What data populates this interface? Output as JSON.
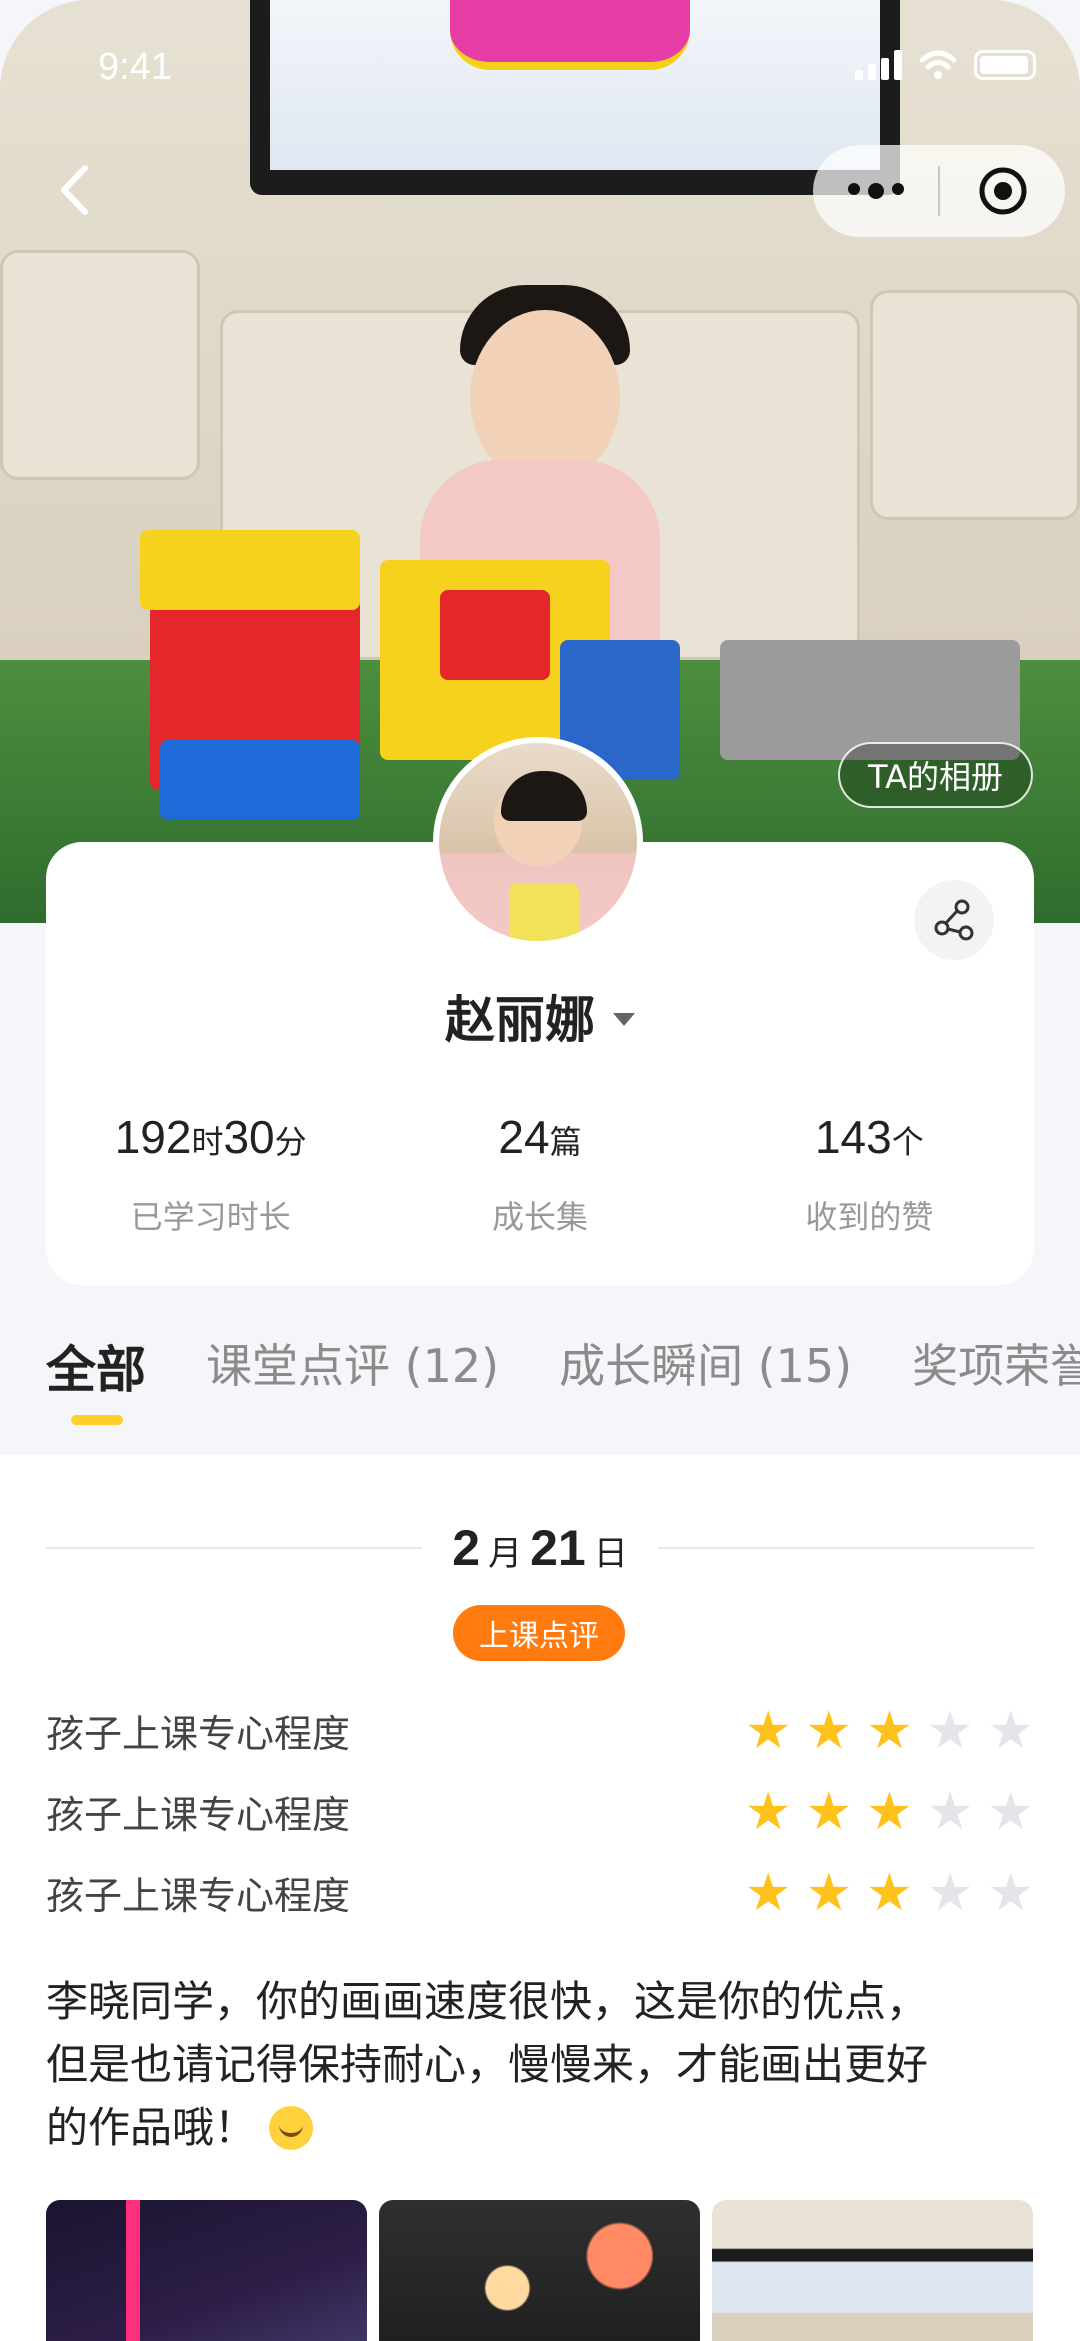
{
  "status_bar": {
    "time": "9:41"
  },
  "hero": {
    "album_button": "TA的相册"
  },
  "profile": {
    "name": "赵丽娜"
  },
  "stats": [
    {
      "num1": "192",
      "unit1": "时",
      "num2": "30",
      "unit2": "分",
      "label": "已学习时长"
    },
    {
      "num1": "24",
      "unit1": "篇",
      "label": "成长集"
    },
    {
      "num1": "143",
      "unit1": "个",
      "label": "收到的赞"
    }
  ],
  "tabs": [
    "全部",
    "课堂点评 (12)",
    "成长瞬间 (15)",
    "奖项荣誉("
  ],
  "feed": {
    "date": {
      "month": "2",
      "month_unit": "月",
      "day": "21",
      "day_unit": "日"
    },
    "tag": "上课点评",
    "ratings": [
      {
        "label": "孩子上课专心程度",
        "stars": 3,
        "max": 5
      },
      {
        "label": "孩子上课专心程度",
        "stars": 3,
        "max": 5
      },
      {
        "label": "孩子上课专心程度",
        "stars": 3,
        "max": 5
      }
    ],
    "comment_lines": [
      "李晓同学，你的画画速度很快，这是你的优点，",
      "但是也请记得保持耐心，慢慢来，才能画出更好",
      "的作品哦！"
    ]
  },
  "colors": {
    "accent_yellow": "#ffd02b",
    "tag_orange": "#ff7a0f",
    "star_on": "#ffc21a",
    "star_off": "#e3e5ea"
  }
}
